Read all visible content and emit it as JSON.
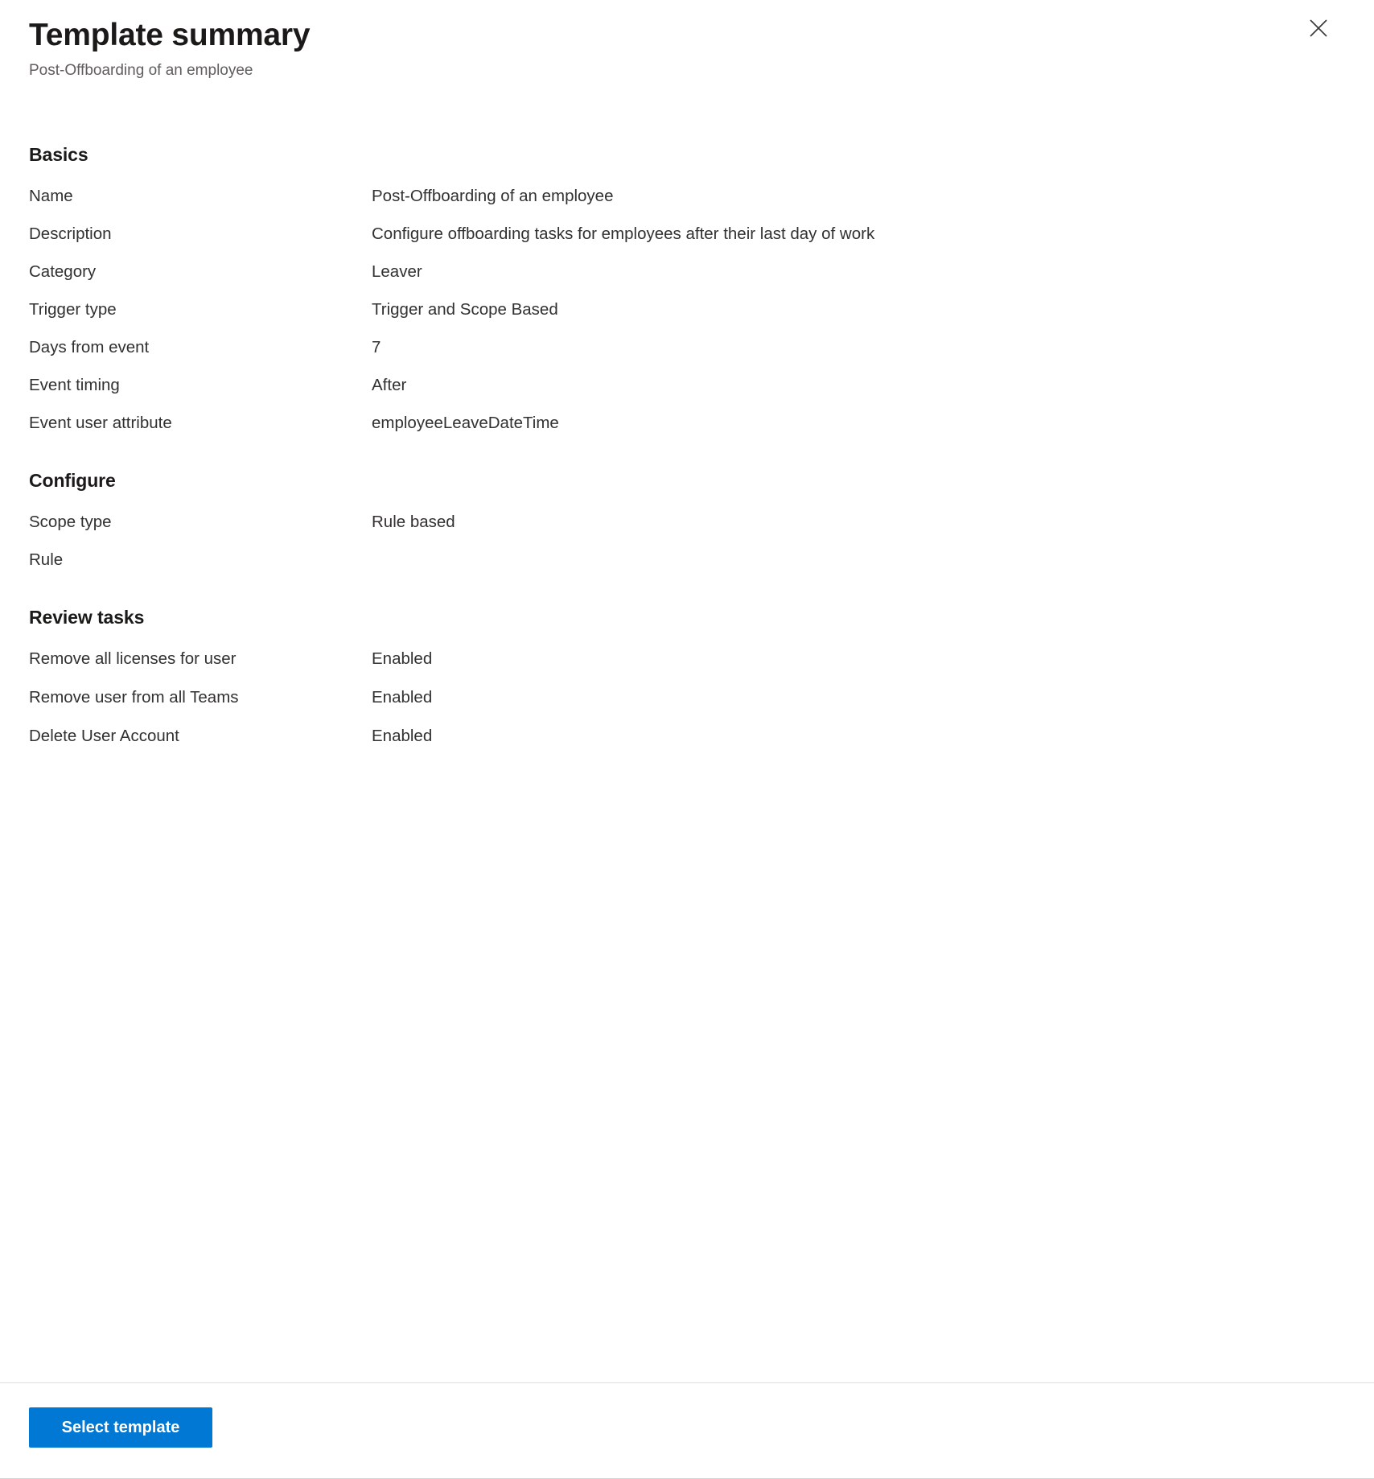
{
  "header": {
    "title": "Template summary",
    "subtitle": "Post-Offboarding of an employee",
    "close_icon": "close-icon"
  },
  "sections": {
    "basics": {
      "title": "Basics",
      "rows": [
        {
          "key": "Name",
          "value": "Post-Offboarding of an employee"
        },
        {
          "key": "Description",
          "value": "Configure offboarding tasks for employees after their last day of work"
        },
        {
          "key": "Category",
          "value": "Leaver"
        },
        {
          "key": "Trigger type",
          "value": "Trigger and Scope Based"
        },
        {
          "key": "Days from event",
          "value": "7"
        },
        {
          "key": "Event timing",
          "value": "After"
        },
        {
          "key": "Event user attribute",
          "value": "employeeLeaveDateTime"
        }
      ]
    },
    "configure": {
      "title": "Configure",
      "rows": [
        {
          "key": "Scope type",
          "value": "Rule based"
        },
        {
          "key": "Rule",
          "value": ""
        }
      ]
    },
    "review_tasks": {
      "title": "Review tasks",
      "rows": [
        {
          "key": "Remove all licenses for user",
          "value": "Enabled"
        },
        {
          "key": "Remove user from all Teams",
          "value": "Enabled"
        },
        {
          "key": "Delete User Account",
          "value": "Enabled"
        }
      ]
    }
  },
  "footer": {
    "select_template_label": "Select template"
  },
  "colors": {
    "accent": "#0078d4",
    "text_primary": "#323130",
    "text_title": "#1b1a19",
    "text_secondary": "#605e5c",
    "divider": "#e1dfdd",
    "button_text": "#ffffff"
  }
}
